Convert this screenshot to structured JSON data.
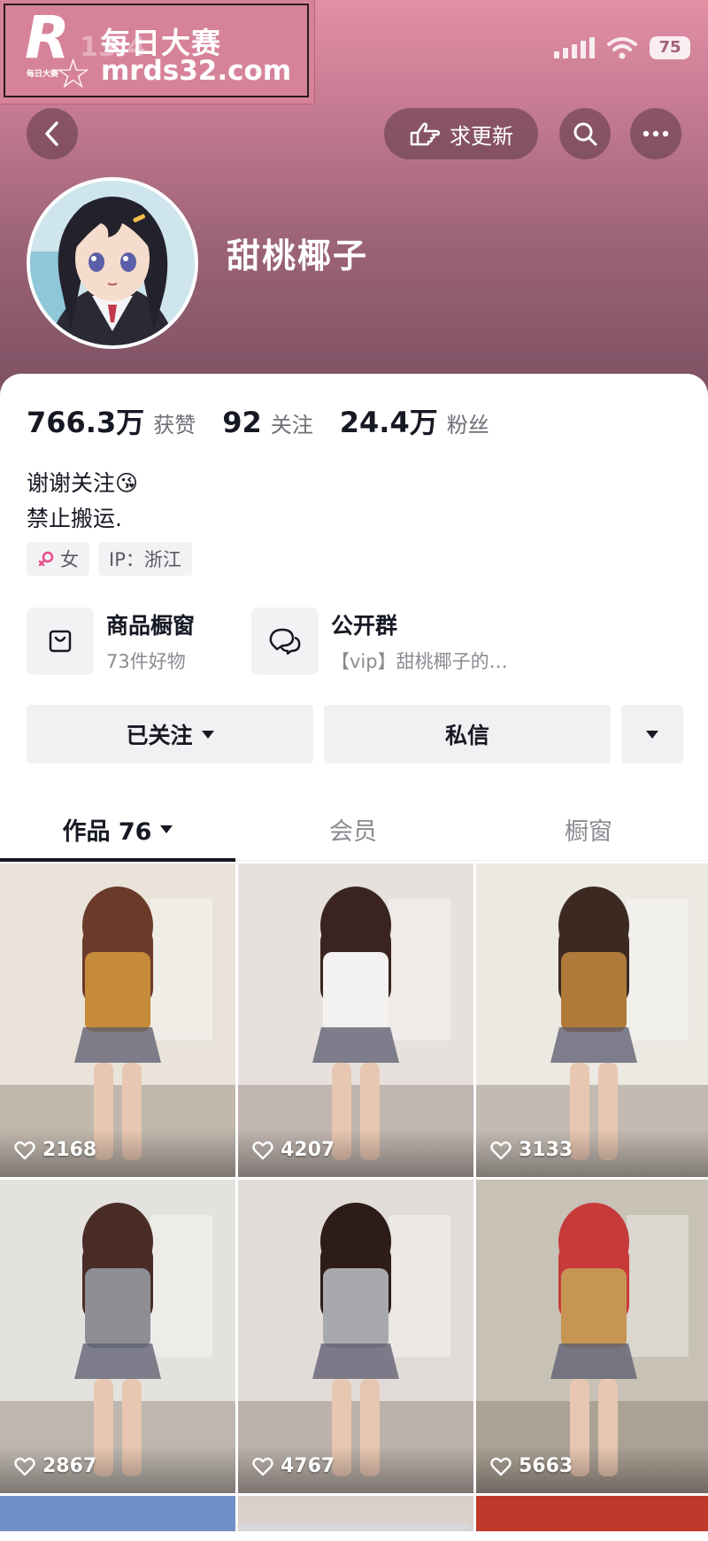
{
  "watermark": {
    "logo_letter": "R",
    "logo_small": "每日大赛",
    "line1": "每日大赛",
    "line2": "mrds32.com",
    "time_ghost": "13:4"
  },
  "status_bar": {
    "battery": "75"
  },
  "top_bar": {
    "update_label": "求更新",
    "back_icon": "chevron-left-icon",
    "search_icon": "search-icon",
    "more_icon": "more-dots-icon"
  },
  "profile": {
    "name": "甜桃椰子"
  },
  "stats": [
    {
      "value": "766.3万",
      "label": "获赞"
    },
    {
      "value": "92",
      "label": "关注"
    },
    {
      "value": "24.4万",
      "label": "粉丝"
    }
  ],
  "bio": {
    "line1": "谢谢关注😘",
    "line2": "禁止搬运."
  },
  "tags": {
    "gender": "女",
    "ip": "IP：浙江"
  },
  "features": {
    "shop": {
      "title": "商品橱窗",
      "subtitle": "73件好物"
    },
    "group": {
      "title": "公开群",
      "subtitle": "【vip】甜桃椰子的…"
    }
  },
  "actions": {
    "follow": "已关注",
    "message": "私信"
  },
  "tabs": {
    "works": "作品 76",
    "members": "会员",
    "window": "橱窗"
  },
  "posts": [
    {
      "likes": "2168",
      "palette": [
        "#e9e3da",
        "#6b3a2a",
        "#c58a3a"
      ]
    },
    {
      "likes": "4207",
      "palette": [
        "#e7e1de",
        "#3a2420",
        "#f4f2f0"
      ]
    },
    {
      "likes": "3133",
      "palette": [
        "#ece8e2",
        "#3c2a22",
        "#b07a3a"
      ]
    },
    {
      "likes": "2867",
      "palette": [
        "#e4e2de",
        "#4a2c26",
        "#8d8f95"
      ]
    },
    {
      "likes": "4767",
      "palette": [
        "#e2dcd8",
        "#2e1c18",
        "#a7a9ae"
      ]
    },
    {
      "likes": "5663",
      "palette": [
        "#c8c2b6",
        "#c73a3a",
        "#c69554"
      ]
    }
  ],
  "colors": {
    "header_top": "#e38fa6",
    "header_bottom": "#7c5062",
    "text_primary": "#161823",
    "text_secondary": "#8a8b91"
  }
}
